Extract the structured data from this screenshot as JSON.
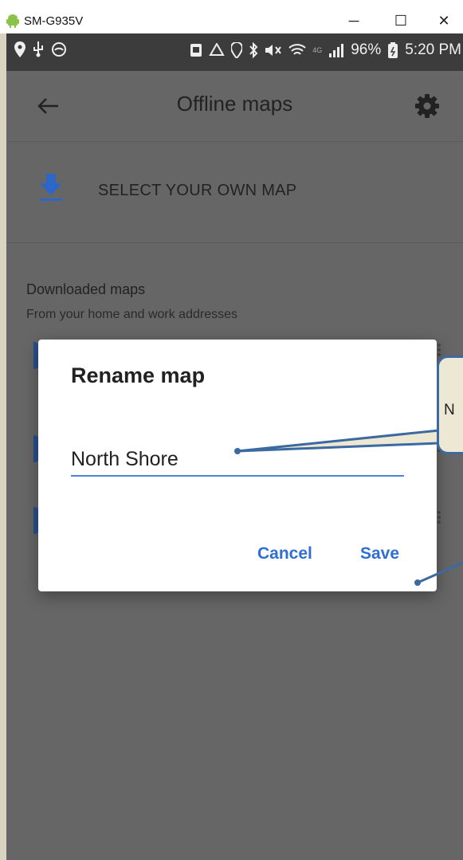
{
  "window": {
    "device_name": "SM-G935V",
    "minimize_glyph": "─",
    "maximize_glyph": "☐",
    "close_glyph": "✕"
  },
  "status_bar": {
    "battery": "96%",
    "time": "5:20 PM",
    "network_badge": "4G"
  },
  "app_bar": {
    "title": "Offline maps",
    "back_icon": "arrow-back-icon",
    "settings_icon": "gear-icon"
  },
  "select_map": {
    "label": "SELECT YOUR OWN MAP",
    "icon": "download-icon"
  },
  "downloaded_section": {
    "title": "Downloaded maps",
    "subtitle": "From your home and work addresses"
  },
  "dialog": {
    "title": "Rename map",
    "input_value": "North Shore",
    "cancel_label": "Cancel",
    "save_label": "Save"
  },
  "callout": {
    "text": "N"
  },
  "colors": {
    "accent": "#2f6fd1",
    "download_icon": "#2c66c8",
    "scrim": "#666666",
    "callout_fill": "#ece8d3",
    "callout_border": "#3c6aa0"
  }
}
